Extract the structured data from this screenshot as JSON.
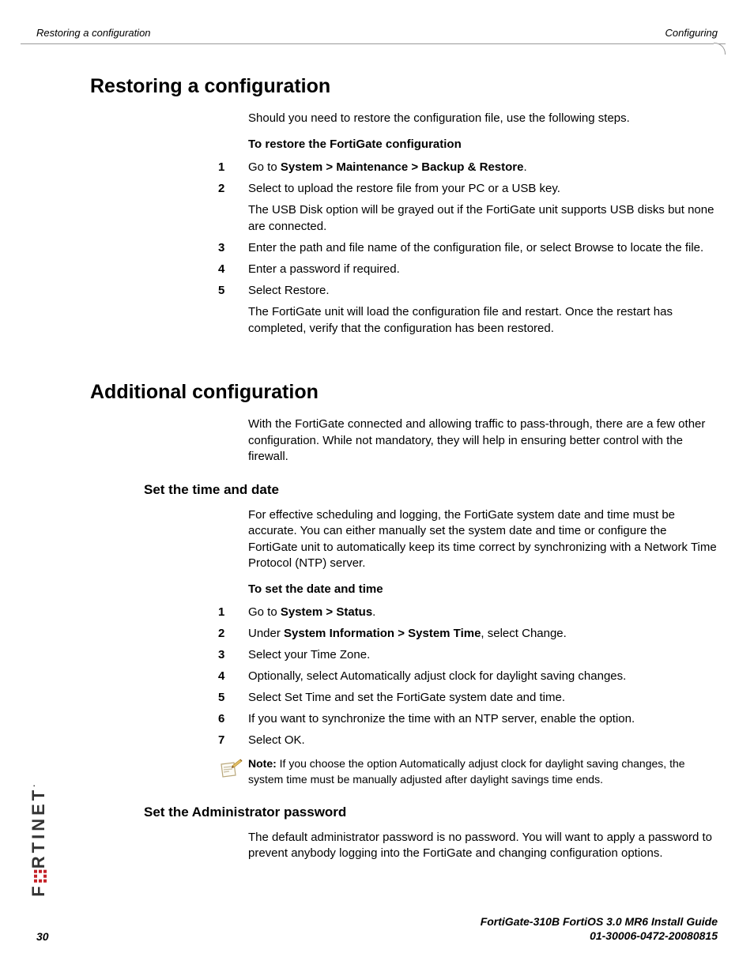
{
  "header": {
    "left": "Restoring a configuration",
    "right": "Configuring"
  },
  "section1": {
    "heading": "Restoring a configuration",
    "intro": "Should you need to restore the configuration file, use the following steps.",
    "subhead": "To restore the FortiGate configuration",
    "steps": [
      {
        "num": "1",
        "html": "Go to <b>System > Maintenance > Backup & Restore</b>."
      },
      {
        "num": "2",
        "html": "Select to upload the restore file from your PC or a USB key.",
        "follow": "The USB Disk option will be grayed out if the FortiGate unit supports USB disks but none are connected."
      },
      {
        "num": "3",
        "html": "Enter the path and file name of the configuration file, or select Browse to locate the file."
      },
      {
        "num": "4",
        "html": "Enter a password if required."
      },
      {
        "num": "5",
        "html": "Select Restore.",
        "follow": "The FortiGate unit will load the configuration file and restart. Once the restart has completed, verify that the configuration has been restored."
      }
    ]
  },
  "section2": {
    "heading": "Additional configuration",
    "intro": "With the FortiGate connected and allowing traffic to pass-through, there are a few other configuration. While not mandatory, they will help in ensuring better control with the firewall.",
    "sub1": {
      "title": "Set the time and date",
      "intro": "For effective scheduling and logging, the FortiGate system date and time must be accurate. You can either manually set the system date and time or configure the FortiGate unit to automatically keep its time correct by synchronizing with a Network Time Protocol (NTP) server.",
      "subhead": "To set the date and time",
      "steps": [
        {
          "num": "1",
          "html": "Go to <b>System > Status</b>."
        },
        {
          "num": "2",
          "html": "Under <b>System Information > System Time</b>, select Change."
        },
        {
          "num": "3",
          "html": "Select your Time Zone."
        },
        {
          "num": "4",
          "html": "Optionally, select Automatically adjust clock for daylight saving changes."
        },
        {
          "num": "5",
          "html": "Select Set Time and set the FortiGate system date and time."
        },
        {
          "num": "6",
          "html": "If you want to synchronize the time with an NTP server, enable the option."
        },
        {
          "num": "7",
          "html": "Select OK."
        }
      ],
      "note_label": "Note:",
      "note": " If you choose the option Automatically adjust clock for daylight saving changes, the system time must be manually adjusted after daylight savings time ends."
    },
    "sub2": {
      "title": "Set the Administrator password",
      "intro": "The default administrator password is no password. You will want to apply a password to prevent anybody logging into the FortiGate and changing configuration options."
    }
  },
  "footer": {
    "page": "30",
    "line1": "FortiGate-310B FortiOS 3.0 MR6 Install Guide",
    "line2": "01-30006-0472-20080815"
  },
  "brand": "F   RTINET"
}
